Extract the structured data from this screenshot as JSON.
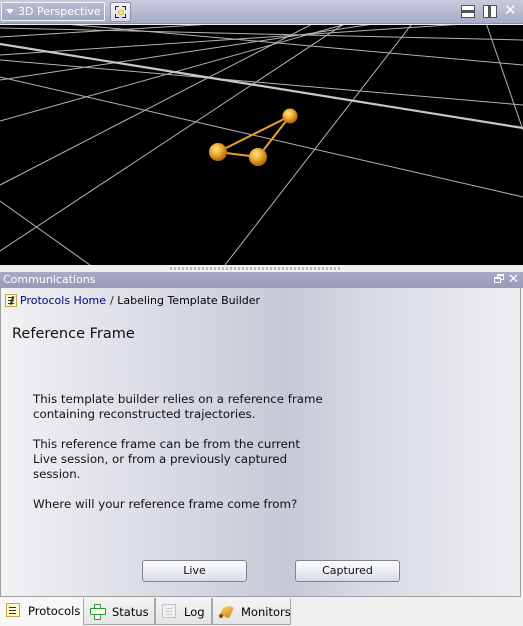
{
  "viewport": {
    "view_select_label": "3D Perspective",
    "icons": {
      "dropdown": "triangle-down-icon",
      "fit": "fit-to-view-icon",
      "split_horizontal": "split-horizontal-icon",
      "split_vertical": "split-vertical-icon",
      "close": "close-icon"
    },
    "close_glyph": "✕",
    "scene": {
      "background": "#000000",
      "grid_color": "#b4b4b4",
      "marker_color": "#f0a020",
      "markers": 3,
      "segments": 3
    }
  },
  "communications": {
    "title": "Communications",
    "close_glyph": "✕",
    "breadcrumb": {
      "home_label": "Protocols Home",
      "separator": "/",
      "current": "Labeling Template Builder"
    },
    "page_title": "Reference Frame",
    "paragraphs": [
      "This template builder relies on a reference frame containing reconstructed trajectories.",
      "This reference frame can be from the current Live session, or from a previously captured session.",
      "Where will your reference frame come from?"
    ],
    "buttons": {
      "live": "Live",
      "captured": "Captured"
    },
    "link_color": "#00008b"
  },
  "tabs": [
    {
      "label": "Protocols",
      "icon": "protocols-icon",
      "active": true
    },
    {
      "label": "Status",
      "icon": "plus-icon",
      "active": false
    },
    {
      "label": "Log",
      "icon": "log-icon",
      "active": false
    },
    {
      "label": "Monitors",
      "icon": "bell-icon",
      "active": false
    }
  ]
}
